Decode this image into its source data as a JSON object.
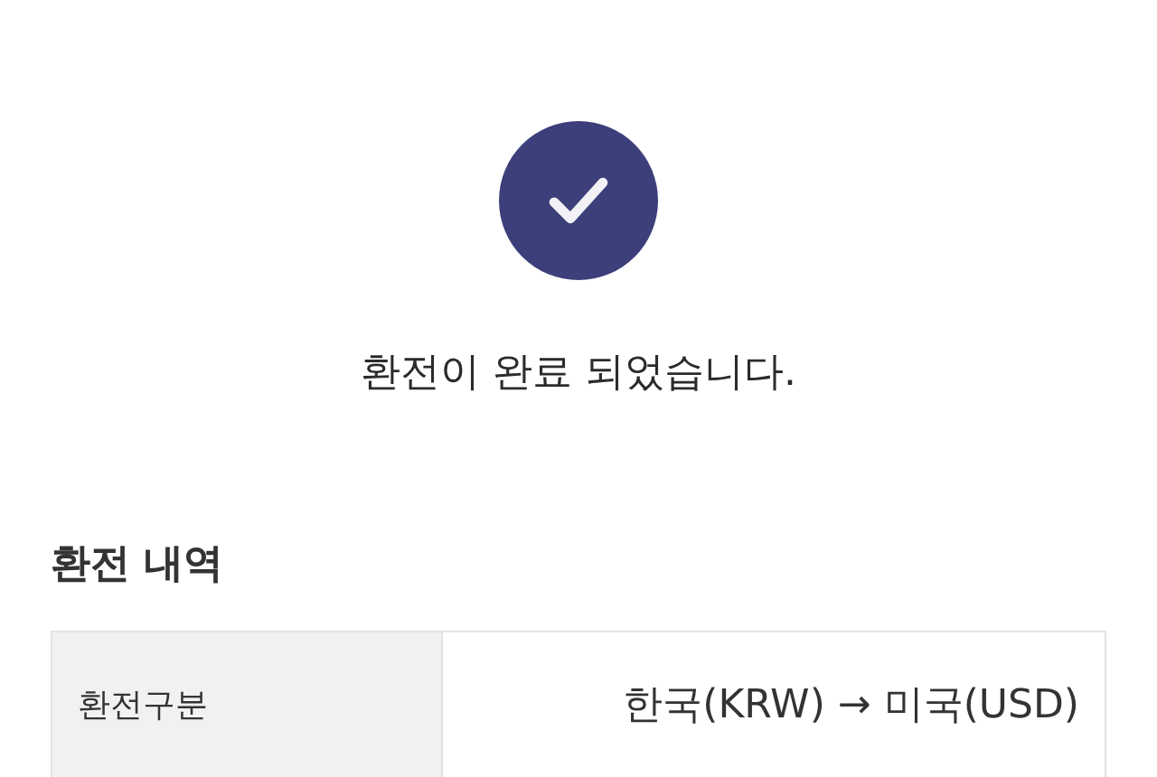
{
  "message": "환전이 완료 되었습니다.",
  "details": {
    "title": "환전 내역",
    "rows": [
      {
        "label": "환전구분",
        "value": "한국(KRW) → 미국(USD)"
      }
    ]
  }
}
